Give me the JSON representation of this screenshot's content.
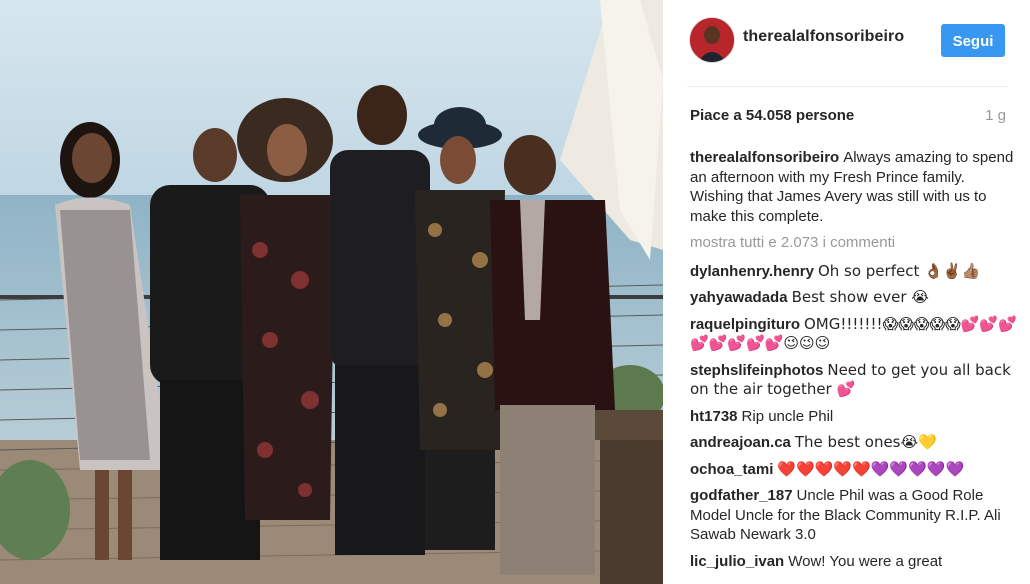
{
  "post": {
    "username": "therealalfonsoribeiro",
    "follow_label": "Segui",
    "likes_text": "Piace a 54.058 persone",
    "time_ago": "1 g",
    "show_all_comments": "mostra tutti e 2.073 i commenti"
  },
  "caption": {
    "author": "therealalfonsoribeiro",
    "text": "Always amazing to spend an afternoon with my Fresh Prince family. Wishing that James Avery was still with us to make this complete."
  },
  "comments": [
    {
      "author": "dylanhenry.henry",
      "text": "Oh so perfect 👌🏾✌🏾👍🏽"
    },
    {
      "author": "yahyawadada",
      "text": "Best show ever 😭"
    },
    {
      "author": "raquelpingituro",
      "text": "OMG!!!!!!!😱😱😱😱😱💕💕💕💕💕💕💕💕😉😉😉"
    },
    {
      "author": "stephslifeinphotos",
      "text": "Need to get you all back on the air together 💕"
    },
    {
      "author": "ht1738",
      "text": "Rip uncle Phil"
    },
    {
      "author": "andreajoan.ca",
      "text": "The best ones😭💛"
    },
    {
      "author": "ochoa_tami",
      "text": "❤️❤️❤️❤️❤️💜💜💜💜💜"
    },
    {
      "author": "godfather_187",
      "text": "Uncle Phil was a Good Role Model Uncle for the Black Community R.I.P. Ali Sawab Newark 3.0"
    },
    {
      "author": "lic_julio_ivan",
      "text": "Wow! You were a great"
    }
  ],
  "colors": {
    "follow_button": "#3897f0",
    "text": "#262626",
    "muted": "#999999"
  }
}
